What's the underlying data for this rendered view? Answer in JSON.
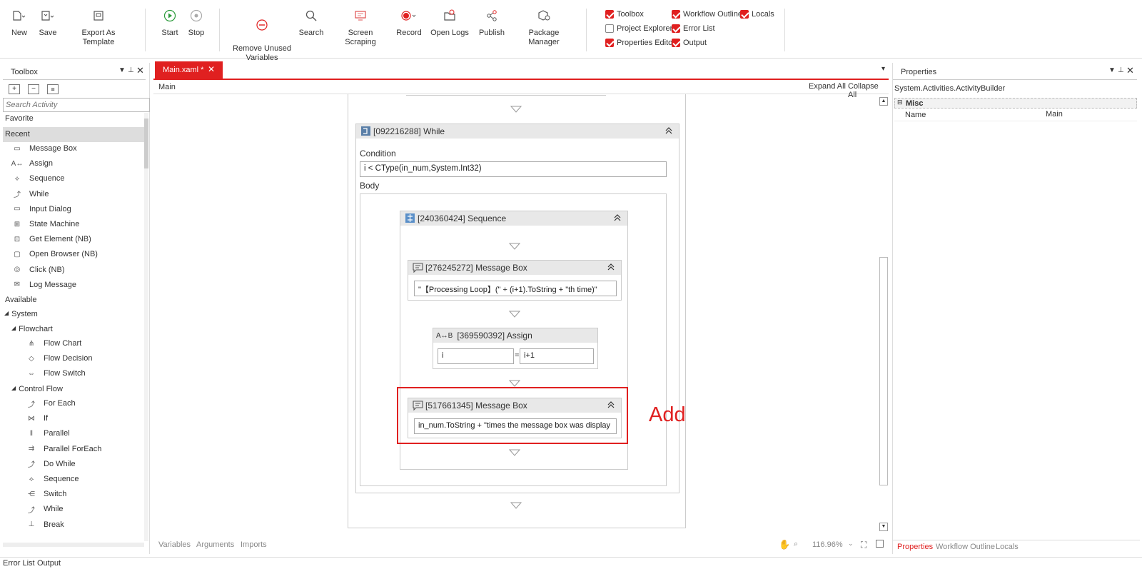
{
  "ribbon": {
    "buttons": [
      {
        "key": "new",
        "label": "New"
      },
      {
        "key": "save",
        "label": "Save"
      },
      {
        "key": "export",
        "label": "Export As Template"
      },
      {
        "key": "start",
        "label": "Start"
      },
      {
        "key": "stop",
        "label": "Stop"
      },
      {
        "key": "remove",
        "label": "Remove Unused\nVariables"
      },
      {
        "key": "search",
        "label": "Search"
      },
      {
        "key": "scraping",
        "label": "Screen Scraping"
      },
      {
        "key": "record",
        "label": "Record"
      },
      {
        "key": "logs",
        "label": "Open Logs"
      },
      {
        "key": "publish",
        "label": "Publish"
      },
      {
        "key": "package",
        "label": "Package Manager"
      }
    ],
    "checks": [
      {
        "label": "Toolbox",
        "checked": true
      },
      {
        "label": "Project Explorer",
        "checked": false
      },
      {
        "label": "Properties Editor",
        "checked": true
      },
      {
        "label": "Workflow Outline",
        "checked": true
      },
      {
        "label": "Error List",
        "checked": true
      },
      {
        "label": "Output",
        "checked": true
      },
      {
        "label": "Locals",
        "checked": true
      }
    ]
  },
  "toolbox": {
    "title": "Toolbox",
    "search_placeholder": "Search Activity",
    "favorite": "Favorite",
    "recent": "Recent",
    "recent_items": [
      "Message Box",
      "Assign",
      "Sequence",
      "While",
      "Input Dialog",
      "State Machine",
      "Get Element (NB)",
      "Open Browser (NB)",
      "Click (NB)",
      "Log Message"
    ],
    "available": "Available",
    "system": "System",
    "flowchart": "Flowchart",
    "flowchart_items": [
      "Flow Chart",
      "Flow Decision",
      "Flow Switch"
    ],
    "control_flow": "Control Flow",
    "control_items": [
      "For Each",
      "If",
      "Parallel",
      "Parallel ForEach",
      "Do While",
      "Sequence",
      "Switch",
      "While",
      "Break"
    ]
  },
  "editor": {
    "tab": "Main.xaml *",
    "breadcrumb": "Main",
    "expand_all": "Expand All",
    "collapse_all": "Collapse All",
    "while_title": "[092216288] While",
    "condition_label": "Condition",
    "condition_value": "i < CType(in_num,System.Int32)",
    "body_label": "Body",
    "sequence_title": "[240360424] Sequence",
    "msg1_title": "[276245272] Message Box",
    "msg1_value": "\"【Processing Loop】(\" + (i+1).ToString + \"th time)\"",
    "assign_title": "[369590392] Assign",
    "assign_left": "i",
    "assign_eq": "=",
    "assign_right": "i+1",
    "msg2_title": "[517661345] Message Box",
    "msg2_value": "in_num.ToString + \"times the message box was display",
    "annotation": "Add",
    "bottom_tabs": [
      "Variables",
      "Arguments",
      "Imports"
    ],
    "zoom": "116.96%"
  },
  "properties": {
    "title": "Properties",
    "type": "System.Activities.ActivityBuilder",
    "category": "Misc",
    "name_label": "Name",
    "name_value": "Main",
    "bottom_tabs": [
      "Properties",
      "Workflow Outline",
      "Locals"
    ]
  },
  "status": {
    "tabs": [
      "Error List",
      "Output"
    ]
  },
  "colors": {
    "accent": "#e02020",
    "header_gray": "#e8e8e8"
  }
}
